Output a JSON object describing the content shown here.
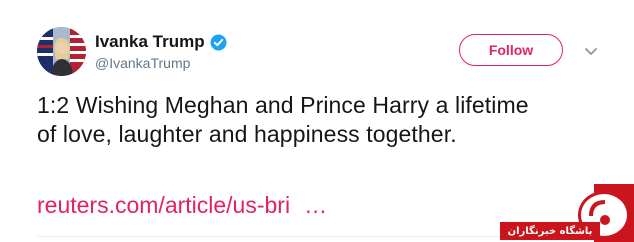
{
  "tweet": {
    "author": {
      "display_name": "Ivanka Trump",
      "handle": "@IvankaTrump",
      "verified_icon": "verified-badge-icon"
    },
    "follow_label": "Follow",
    "text": "1:2 Wishing Meghan and Prince Harry a lifetime of love, laughter and happiness together.",
    "link_text": "reuters.com/article/us-bri",
    "link_ellipsis": "…"
  },
  "watermark": {
    "text": "باشگاه خبرنگاران"
  },
  "colors": {
    "accent": "#e0245e",
    "verified": "#1da1f2",
    "text": "#14171a",
    "muted": "#657786",
    "watermark_red": "#c9151b"
  }
}
